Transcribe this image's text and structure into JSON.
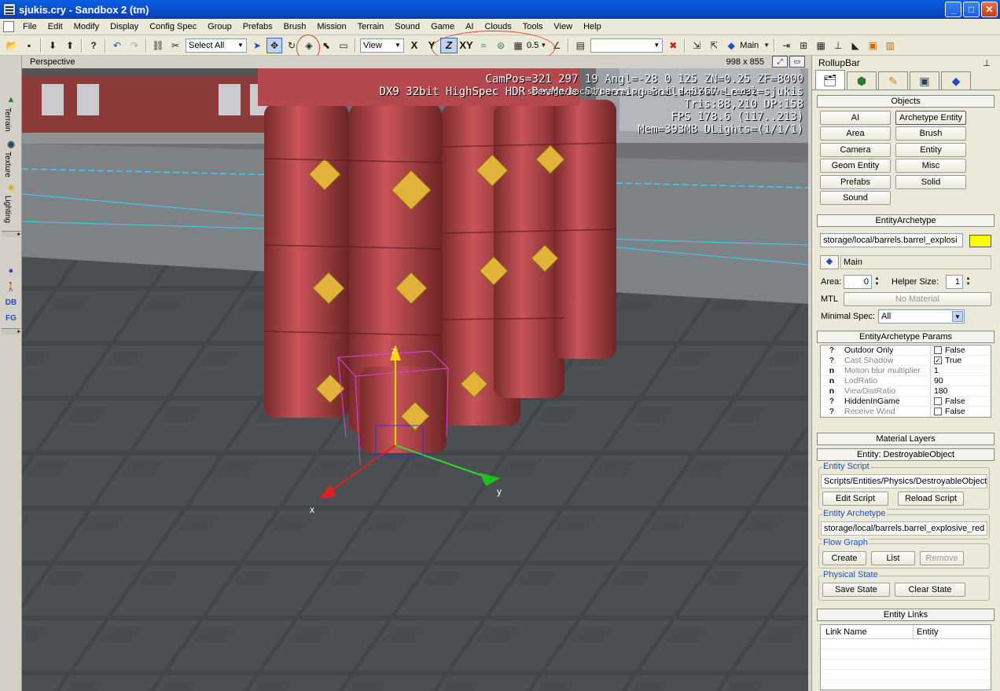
{
  "window": {
    "title": "sjukis.cry - Sandbox 2 (tm)"
  },
  "menu": [
    "File",
    "Edit",
    "Modify",
    "Display",
    "Config Spec",
    "Group",
    "Prefabs",
    "Brush",
    "Mission",
    "Terrain",
    "Sound",
    "Game",
    "AI",
    "Clouds",
    "Tools",
    "View",
    "Help"
  ],
  "toolbar": {
    "select_combo": "Select All",
    "view_combo": "View",
    "axes": [
      "X",
      "Y",
      "Z",
      "XY"
    ],
    "grid_value": "0.5",
    "layer_label": "Main"
  },
  "viewport": {
    "name": "Perspective",
    "resolution": "998 x 855",
    "hud_lines": [
      "CamPos=321 297  19 Angl=-28  0 125 ZN=0.25 ZF=8000",
      "DX9 32bit HighSpec HDR DevMode Streaming Build=5767 Level=sjukis",
      "Tris:88,210  DP:158",
      "FPS 178.6 (117..213)",
      "Mem=393MB DLights=(1/1/1)"
    ],
    "hover_hint": "storage/local/barrels.barrel_explosive_red32",
    "gizmo": {
      "x": "x",
      "y": "y",
      "z": "z"
    }
  },
  "leftbar": {
    "tabs": [
      "Terrain",
      "Texture",
      "Lighting"
    ],
    "labels": {
      "db": "DB",
      "fg": "FG"
    }
  },
  "rollup": {
    "title": "RollupBar",
    "objects": {
      "header": "Objects",
      "buttons": [
        "AI",
        "Archetype Entity",
        "Area",
        "Brush",
        "Camera",
        "Entity",
        "Geom Entity",
        "Misc",
        "Prefabs",
        "Solid",
        "Sound"
      ]
    },
    "archetype": {
      "header": "EntityArchetype",
      "path": "storage/local/barrels.barrel_explosi",
      "color": "#ffff00",
      "layer": "Main",
      "area_label": "Area:",
      "area_value": "0",
      "helper_label": "Helper Size:",
      "helper_value": "1",
      "mtl_label": "MTL",
      "mtl_value": "No Material",
      "minspec_label": "Minimal Spec:",
      "minspec_value": "All"
    },
    "params": {
      "header": "EntityArchetype Params",
      "rows": [
        {
          "icon": "?",
          "name": "Outdoor Only",
          "value": "False",
          "check": false,
          "grey": false
        },
        {
          "icon": "?",
          "name": "Cast Shadow",
          "value": "True",
          "check": true,
          "grey": true
        },
        {
          "icon": "n",
          "name": "Motion blur multiplier",
          "value": "1",
          "grey": true
        },
        {
          "icon": "n",
          "name": "LodRatio",
          "value": "90",
          "grey": true
        },
        {
          "icon": "n",
          "name": "ViewDistRatio",
          "value": "180",
          "grey": true
        },
        {
          "icon": "?",
          "name": "HiddenInGame",
          "value": "False",
          "check": false,
          "grey": false
        },
        {
          "icon": "?",
          "name": "Receive Wind",
          "value": "False",
          "check": false,
          "grey": true
        }
      ]
    },
    "material_layers": {
      "header": "Material Layers"
    },
    "entity": {
      "header": "Entity: DestroyableObject",
      "script_label": "Entity Script",
      "script_path": "Scripts/Entities/Physics/DestroyableObject",
      "edit_script": "Edit Script",
      "reload_script": "Reload Script",
      "archetype_label": "Entity Archetype",
      "archetype_path": "storage/local/barrels.barrel_explosive_red",
      "flowgraph_label": "Flow Graph",
      "create": "Create",
      "list": "List",
      "remove": "Remove",
      "physical_label": "Physical State",
      "save_state": "Save State",
      "clear_state": "Clear State"
    },
    "links": {
      "header": "Entity Links",
      "col_name": "Link Name",
      "col_entity": "Entity"
    }
  }
}
